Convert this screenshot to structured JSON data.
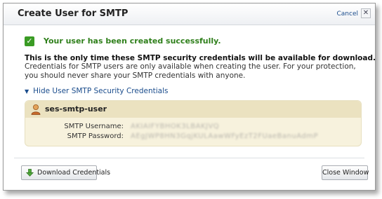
{
  "dialog": {
    "title": "Create User for SMTP",
    "cancel_label": "Cancel",
    "close_glyph": "✕"
  },
  "success": {
    "icon": "check-icon",
    "message": "Your user has been created successfully."
  },
  "info": {
    "bold": "This is the only time these SMTP security credentials will be available for download.",
    "text": "Credentials for SMTP users are only available when creating the user. For your protection, you should never share your SMTP credentials with anyone."
  },
  "toggle": {
    "label": "Hide User SMTP Security Credentials"
  },
  "credentials": {
    "user_name": "ses-smtp-user",
    "username_label": "SMTP Username:",
    "username_value": "AKIAIFYBHOK3LBAKJVQ",
    "password_label": "SMTP Password:",
    "password_value": "AEgJWP8HN3GqjKULAawWFyEzT2FUaeBanuAdmP"
  },
  "footer": {
    "download_label": "Download Credentials",
    "close_label": "Close Window"
  },
  "colors": {
    "success_green": "#2e7f1a",
    "link_blue": "#1a4c8c",
    "cred_box_bg": "#f7f2dd"
  }
}
